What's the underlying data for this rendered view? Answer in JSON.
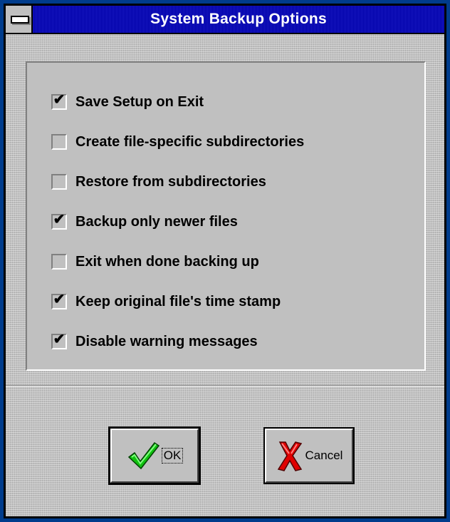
{
  "window": {
    "title": "System Backup Options"
  },
  "options": [
    {
      "label": "Save Setup on Exit",
      "checked": true
    },
    {
      "label": "Create file-specific subdirectories",
      "checked": false
    },
    {
      "label": "Restore from subdirectories",
      "checked": false
    },
    {
      "label": "Backup only newer files",
      "checked": true
    },
    {
      "label": "Exit when done backing up",
      "checked": false
    },
    {
      "label": "Keep original file's time stamp",
      "checked": true
    },
    {
      "label": "Disable warning messages",
      "checked": true
    }
  ],
  "buttons": {
    "ok_label": "OK",
    "cancel_label": "Cancel"
  },
  "icons": {
    "system_menu": "system-menu-icon",
    "ok": "green-checkmark-icon",
    "cancel": "red-x-icon"
  },
  "colors": {
    "titlebar": "#0000a8",
    "face": "#c0c0c0",
    "ok_icon": "#10c010",
    "cancel_icon": "#e00000"
  }
}
